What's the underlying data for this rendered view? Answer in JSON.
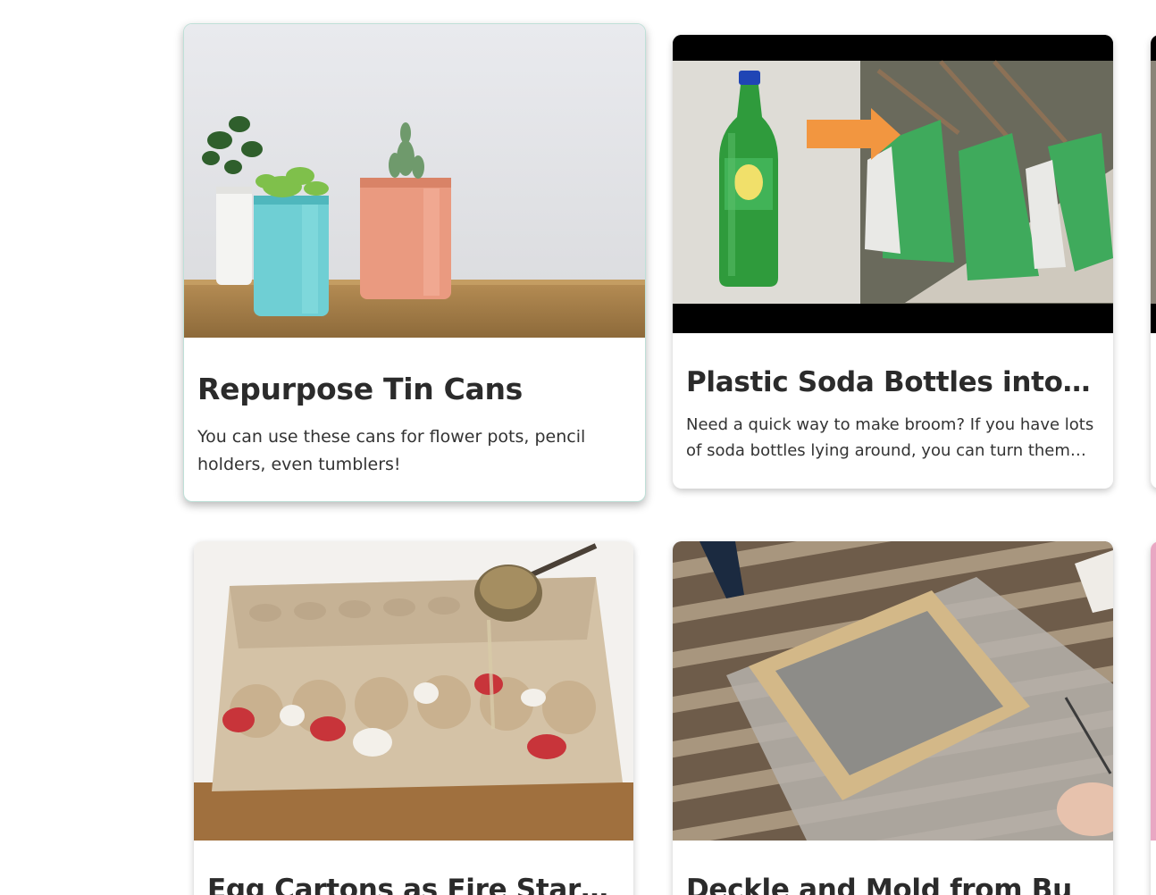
{
  "cards": [
    {
      "title": "Repurpose Tin Cans",
      "description": "You can use these cans for flower pots, pencil holders, even tumblers!",
      "image_icon": "tin-can-planters-photo"
    },
    {
      "title": "Plastic Soda Bottles into Brooms",
      "description": "Need a quick way to make broom? If you have lots of soda bottles lying around, you can turn them into brooms.",
      "image_icon": "soda-bottle-broom-photo"
    },
    {
      "title": "Egg Cartons as Fire Starters",
      "image_icon": "egg-carton-photo"
    },
    {
      "title": "Deckle and Mold from Bu",
      "image_icon": "deckle-mold-photo"
    }
  ]
}
